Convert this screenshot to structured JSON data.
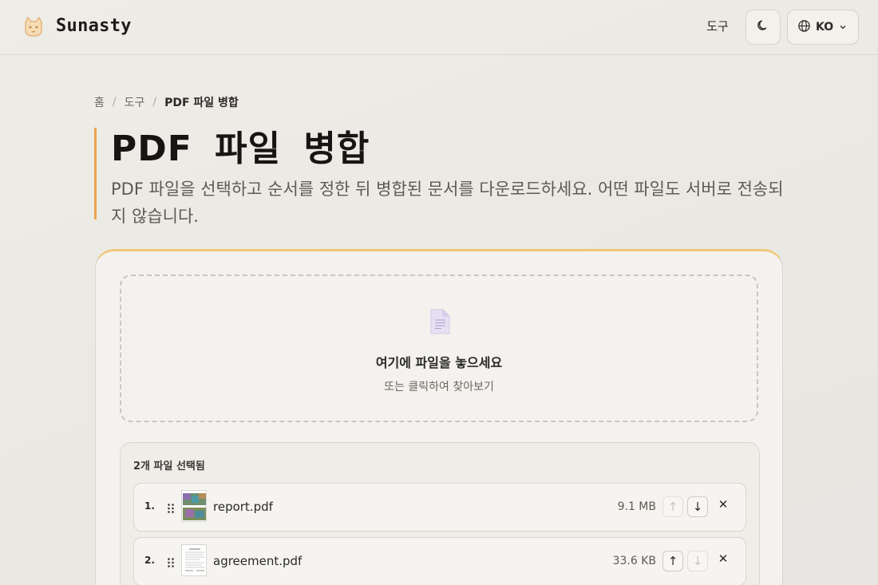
{
  "header": {
    "brand": "Sunasty",
    "nav_tools": "도구",
    "language": "KO"
  },
  "breadcrumb": {
    "home": "홈",
    "tools": "도구",
    "current": "PDF 파일 병합",
    "separator": "/"
  },
  "page": {
    "title": "PDF 파일 병합",
    "description": "PDF 파일을 선택하고 순서를 정한 뒤 병합된 문서를 다운로드하세요. 어떤 파일도 서버로 전송되지 않습니다."
  },
  "dropzone": {
    "title": "여기에 파일을 놓으세요",
    "subtitle": "또는 클릭하여 찾아보기"
  },
  "files": {
    "count_label": "2개 파일 선택됨",
    "items": [
      {
        "index": "1.",
        "name": "report.pdf",
        "size": "9.1 MB",
        "up_enabled": false,
        "down_enabled": true
      },
      {
        "index": "2.",
        "name": "agreement.pdf",
        "size": "33.6 KB",
        "up_enabled": true,
        "down_enabled": false
      }
    ],
    "up_symbol": "↑",
    "down_symbol": "↓",
    "remove_symbol": "✕"
  },
  "colors": {
    "accent": "#e8a450",
    "card_top": "#f0c878",
    "icon_doc": "#d9d3ec"
  },
  "icons": {
    "logo": "cat-logo-icon",
    "theme": "moon-icon",
    "language": "globe-icon",
    "dropdown": "chevron-down-icon",
    "drop": "document-icon",
    "drag": "drag-handle-icon",
    "remove": "close-icon"
  }
}
